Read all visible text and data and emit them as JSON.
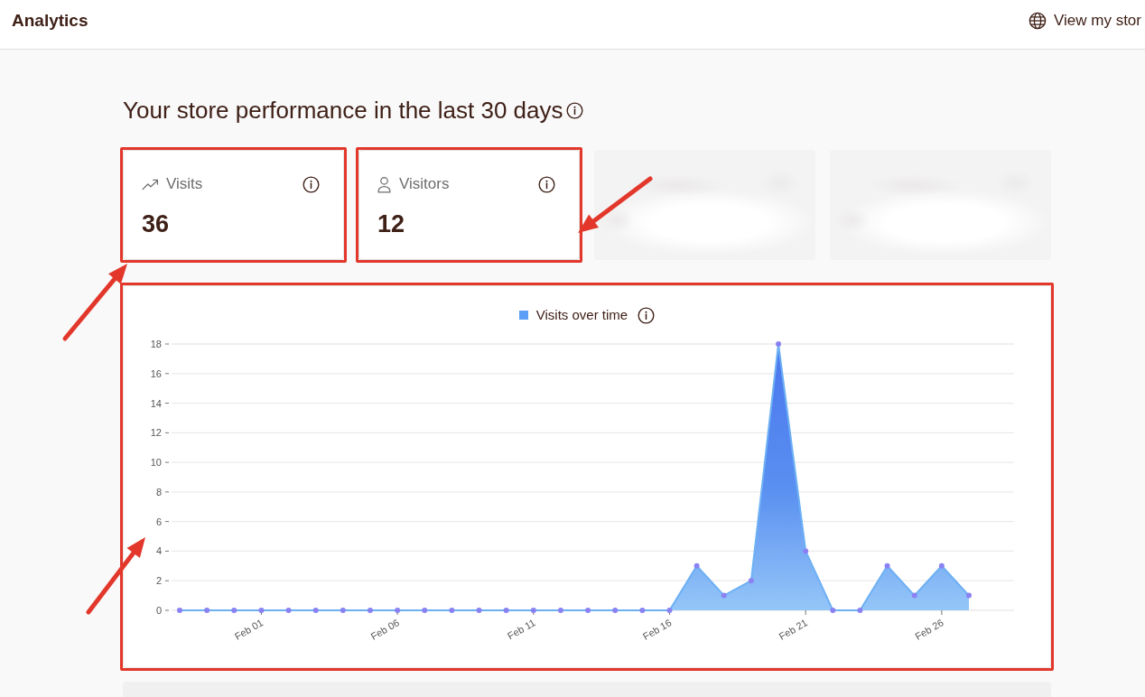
{
  "header": {
    "title": "Analytics",
    "store_link": {
      "label": "View my stor"
    }
  },
  "page_title": "Your store performance in the last 30 days",
  "metric_cards": [
    {
      "kind": "visits",
      "label": "Visits",
      "value": "36",
      "highlighted": true,
      "arrow": true
    },
    {
      "kind": "visitors",
      "label": "Visitors",
      "value": "12",
      "highlighted": true,
      "arrow": true
    },
    {
      "kind": "blurred"
    },
    {
      "kind": "blurred"
    }
  ],
  "chart_panel": {
    "highlighted": true,
    "arrow": true,
    "chart_data": {
      "type": "area",
      "categories": [
        null,
        null,
        null,
        "Feb 01",
        null,
        null,
        null,
        null,
        "Feb 06",
        null,
        null,
        null,
        null,
        "Feb 11",
        null,
        null,
        null,
        null,
        "Feb 16",
        null,
        null,
        null,
        null,
        "Feb 21",
        null,
        null,
        null,
        null,
        "Feb 26",
        null
      ],
      "series": [
        {
          "name": "Visits over time",
          "color": "#5b9ef5",
          "values": [
            0,
            0,
            0,
            0,
            0,
            0,
            0,
            0,
            0,
            0,
            0,
            0,
            0,
            0,
            0,
            0,
            0,
            0,
            0,
            3,
            1,
            2,
            18,
            4,
            0,
            0,
            3,
            1,
            3,
            1
          ]
        }
      ],
      "ylim": [
        0,
        18
      ],
      "yticks": [
        0,
        2,
        4,
        6,
        8,
        10,
        12,
        14,
        16,
        18
      ],
      "grid": true
    }
  },
  "next_panel": {
    "kind": "blurred"
  }
}
